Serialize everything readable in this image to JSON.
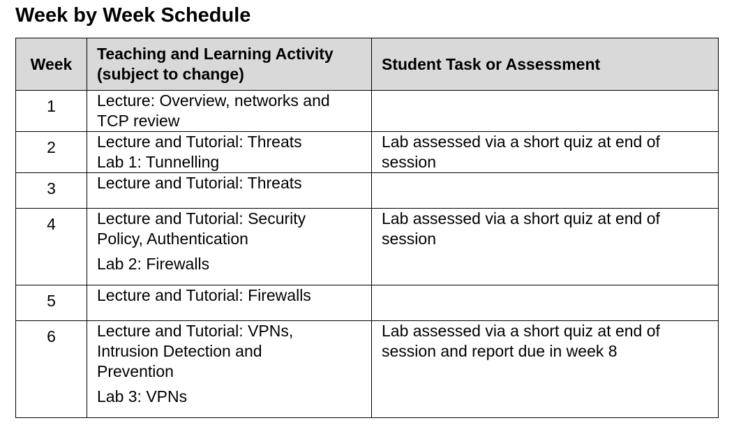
{
  "title": "Week by Week Schedule",
  "headers": {
    "week": "Week",
    "activity_line1": "Teaching and Learning Activity",
    "activity_line2": "(subject to change)",
    "task": "Student Task or Assessment"
  },
  "rows": [
    {
      "week": "1",
      "activity": [
        "Lecture: Overview, networks and",
        "TCP review"
      ],
      "task": []
    },
    {
      "week": "2",
      "activity": [
        "Lecture and Tutorial: Threats",
        "Lab 1: Tunnelling"
      ],
      "task": [
        "Lab assessed via a short quiz at end of",
        "session"
      ]
    },
    {
      "week": "3",
      "activity": [
        "Lecture and Tutorial: Threats"
      ],
      "task": []
    },
    {
      "week": "4",
      "activity": [
        "Lecture and Tutorial: Security",
        "Policy, Authentication",
        "Lab 2: Firewalls"
      ],
      "task": [
        "Lab assessed via a short quiz at end of",
        "session"
      ]
    },
    {
      "week": "5",
      "activity": [
        "Lecture and Tutorial: Firewalls"
      ],
      "task": []
    },
    {
      "week": "6",
      "activity": [
        "Lecture and Tutorial: VPNs,",
        "Intrusion Detection and",
        "Prevention",
        "Lab 3: VPNs"
      ],
      "task": [
        "Lab assessed via a short quiz at end of",
        "session and report due in week 8"
      ]
    }
  ]
}
